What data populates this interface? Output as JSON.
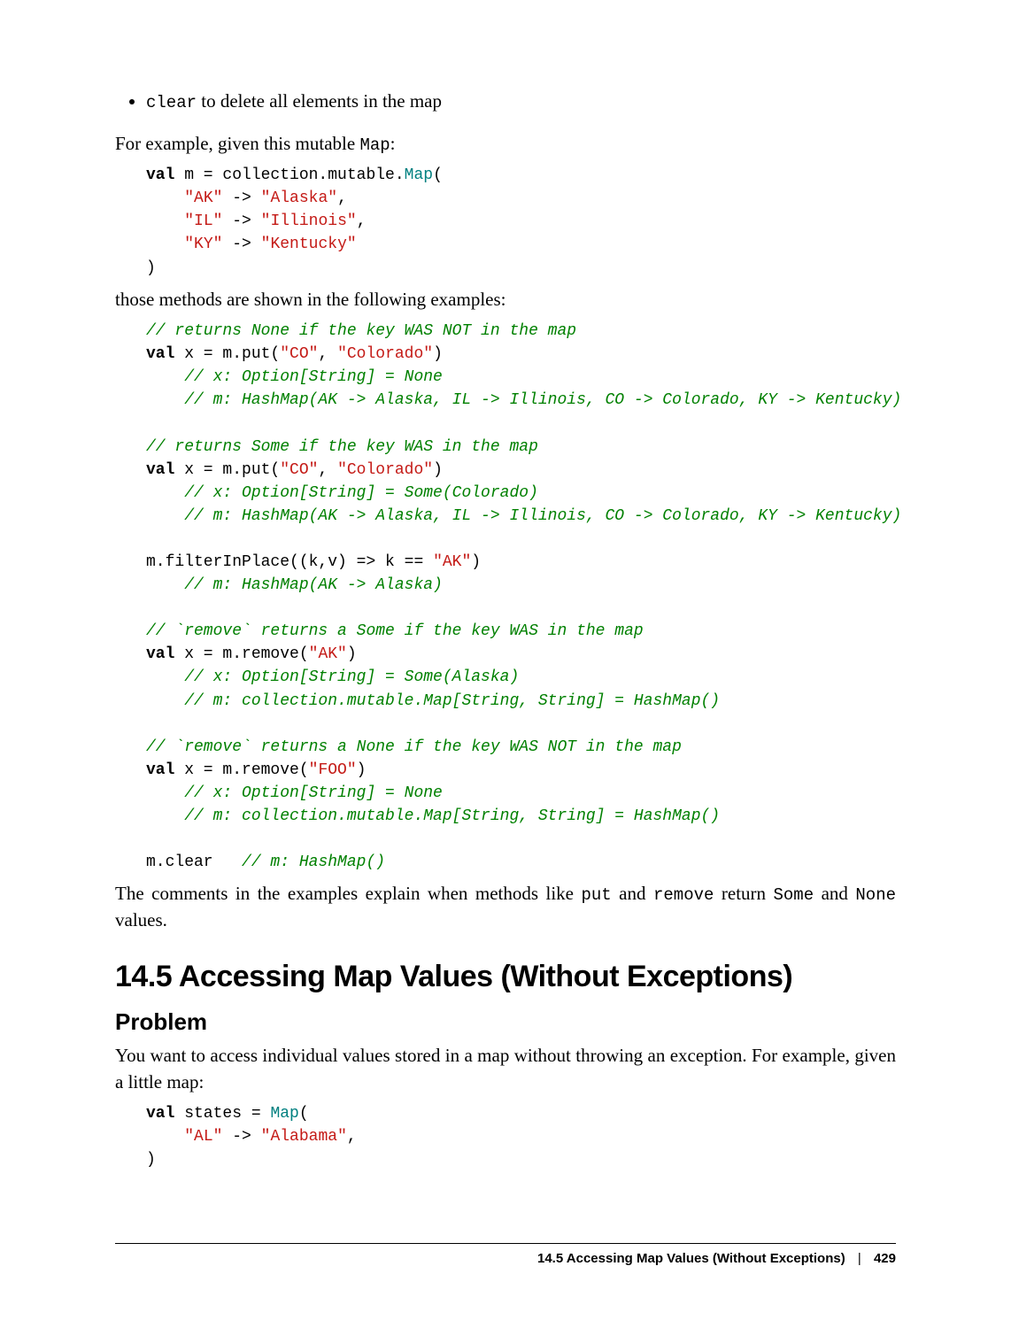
{
  "bullet": {
    "clear_code": "clear",
    "clear_text": " to delete all elements in the map"
  },
  "p1_a": "For example, given this mutable ",
  "p1_code": "Map",
  "p1_b": ":",
  "code1": {
    "l1_kw": "val",
    "l1_rest": " m = collection.mutable.",
    "l1_type": "Map",
    "l1_end": "(",
    "l2_a": "    ",
    "l2_s1": "\"AK\"",
    "l2_mid": " -> ",
    "l2_s2": "\"Alaska\"",
    "l2_end": ",",
    "l3_a": "    ",
    "l3_s1": "\"IL\"",
    "l3_mid": " -> ",
    "l3_s2": "\"Illinois\"",
    "l3_end": ",",
    "l4_a": "    ",
    "l4_s1": "\"KY\"",
    "l4_mid": " -> ",
    "l4_s2": "\"Kentucky\"",
    "l5": ")"
  },
  "p2": "those methods are shown in the following examples:",
  "code2": {
    "c1": "// returns None if the key WAS NOT in the map",
    "l1_kw": "val",
    "l1_a": " x = m.put(",
    "l1_s1": "\"CO\"",
    "l1_mid": ", ",
    "l1_s2": "\"Colorado\"",
    "l1_end": ")",
    "c2": "    // x: Option[String] = None",
    "c3": "    // m: HashMap(AK -> Alaska, IL -> Illinois, CO -> Colorado, KY -> Kentucky)",
    "c4": "// returns Some if the key WAS in the map",
    "l2_kw": "val",
    "l2_a": " x = m.put(",
    "l2_s1": "\"CO\"",
    "l2_mid": ", ",
    "l2_s2": "\"Colorado\"",
    "l2_end": ")",
    "c5": "    // x: Option[String] = Some(Colorado)",
    "c6": "    // m: HashMap(AK -> Alaska, IL -> Illinois, CO -> Colorado, KY -> Kentucky)",
    "l3_a": "m.filterInPlace((k,v) => k == ",
    "l3_s1": "\"AK\"",
    "l3_end": ")",
    "c7": "    // m: HashMap(AK -> Alaska)",
    "c8": "// `remove` returns a Some if the key WAS in the map",
    "l4_kw": "val",
    "l4_a": " x = m.remove(",
    "l4_s1": "\"AK\"",
    "l4_end": ")",
    "c9": "    // x: Option[String] = Some(Alaska)",
    "c10": "    // m: collection.mutable.Map[String, String] = HashMap()",
    "c11": "// `remove` returns a None if the key WAS NOT in the map",
    "l5_kw": "val",
    "l5_a": " x = m.remove(",
    "l5_s1": "\"FOO\"",
    "l5_end": ")",
    "c12": "    // x: Option[String] = None",
    "c13": "    // m: collection.mutable.Map[String, String] = HashMap()",
    "l6_a": "m.clear   ",
    "c14": "// m: HashMap()"
  },
  "p3_a": "The comments in the examples explain when methods like ",
  "p3_code1": "put",
  "p3_b": " and ",
  "p3_code2": "remove",
  "p3_c": " return ",
  "p3_code3": "Some",
  "p3_d": " and ",
  "p3_code4": "None",
  "p3_e": " values.",
  "section_title": "14.5 Accessing Map Values (Without Exceptions)",
  "subsection_title": "Problem",
  "p4": "You want to access individual values stored in a map without throwing an exception. For example, given a little map:",
  "code3": {
    "l1_kw": "val",
    "l1_a": " states = ",
    "l1_type": "Map",
    "l1_end": "(",
    "l2_a": "    ",
    "l2_s1": "\"AL\"",
    "l2_mid": " -> ",
    "l2_s2": "\"Alabama\"",
    "l2_end": ",",
    "l3": ")"
  },
  "footer": {
    "title": "14.5 Accessing Map Values (Without Exceptions)",
    "sep": "|",
    "page": "429"
  }
}
